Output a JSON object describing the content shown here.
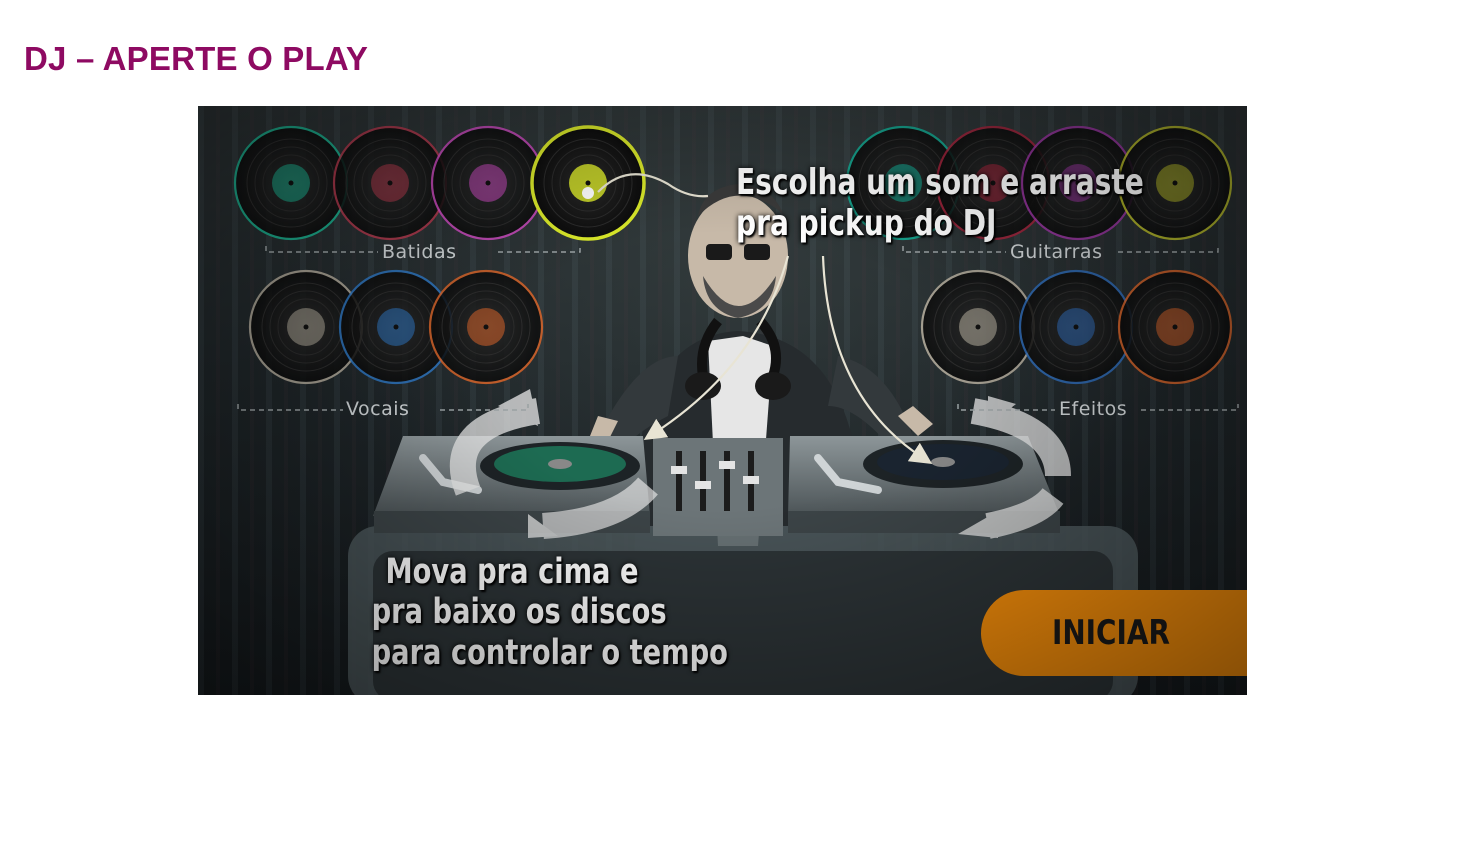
{
  "page": {
    "title": "DJ – APERTE O PLAY"
  },
  "game": {
    "sections": {
      "beats": "Batidas",
      "guitars": "Guitarras",
      "vocals": "Vocais",
      "effects": "Efeitos"
    },
    "instructions": {
      "choose_line1": "Escolha um som e arraste",
      "choose_line2": "pra pickup do DJ",
      "move_line1": "Mova pra cima e",
      "move_line2": "pra baixo os discos",
      "move_line3": "para controlar o tempo"
    },
    "start_button": "INICIAR",
    "record_colors": {
      "beats": [
        "#1bbf9a",
        "#b83a4f",
        "#d14cc4",
        "#d9e82a"
      ],
      "guitars": [
        "#12b39a",
        "#a8243d",
        "#9e36a6",
        "#c3c72a"
      ],
      "vocals": [
        "#b8b0a0",
        "#2f78c4",
        "#d9652a"
      ],
      "effects": [
        "#b8b0a0",
        "#2f6cb8",
        "#d9652a"
      ]
    },
    "selected_record": "beats-4"
  }
}
